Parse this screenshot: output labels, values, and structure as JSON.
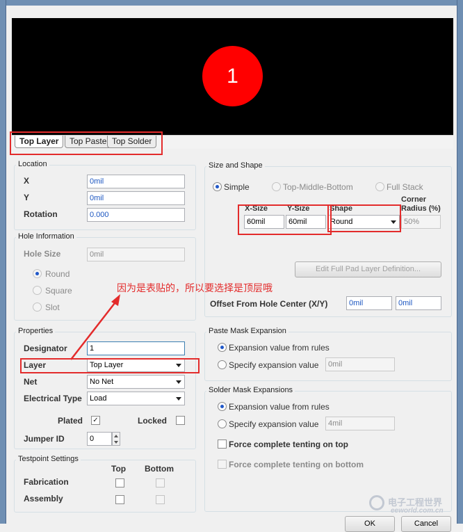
{
  "preview": {
    "pad_number": "1"
  },
  "tabs": [
    "Top Layer",
    "Top Paste",
    "Top Solder"
  ],
  "location": {
    "legend": "Location",
    "x_label": "X",
    "x_value": "0mil",
    "y_label": "Y",
    "y_value": "0mil",
    "rotation_label": "Rotation",
    "rotation_value": "0.000"
  },
  "hole": {
    "legend": "Hole Information",
    "size_label": "Hole Size",
    "size_value": "0mil",
    "round": "Round",
    "square": "Square",
    "slot": "Slot"
  },
  "properties": {
    "legend": "Properties",
    "designator_label": "Designator",
    "designator_value": "1",
    "layer_label": "Layer",
    "layer_value": "Top Layer",
    "net_label": "Net",
    "net_value": "No Net",
    "etype_label": "Electrical Type",
    "etype_value": "Load",
    "plated_label": "Plated",
    "plated_mark": "✓",
    "locked_label": "Locked",
    "jumper_label": "Jumper ID",
    "jumper_value": "0"
  },
  "testpoint": {
    "legend": "Testpoint Settings",
    "top": "Top",
    "bottom": "Bottom",
    "fabrication": "Fabrication",
    "assembly": "Assembly"
  },
  "size_shape": {
    "legend": "Size and Shape",
    "simple": "Simple",
    "tmb": "Top-Middle-Bottom",
    "full_stack": "Full Stack",
    "xsize_hdr": "X-Size",
    "ysize_hdr": "Y-Size",
    "shape_hdr": "Shape",
    "corner_hdr_1": "Corner",
    "corner_hdr_2": "Radius (%)",
    "xsize": "60mil",
    "ysize": "60mil",
    "shape": "Round",
    "corner": "50%",
    "edit_button": "Edit Full Pad Layer Definition...",
    "offset_label": "Offset From Hole Center (X/Y)",
    "offset_x": "0mil",
    "offset_y": "0mil"
  },
  "paste": {
    "legend": "Paste Mask Expansion",
    "from_rules": "Expansion value from rules",
    "specify": "Specify expansion value",
    "value": "0mil"
  },
  "solder": {
    "legend": "Solder Mask Expansions",
    "from_rules": "Expansion value from rules",
    "specify": "Specify expansion value",
    "value": "4mil",
    "tent_top": "Force complete tenting on top",
    "tent_bottom": "Force complete tenting on bottom"
  },
  "buttons": {
    "ok": "OK",
    "cancel": "Cancel"
  },
  "annotation": "因为是表贴的，所以要选择是顶层哦",
  "watermark": {
    "cn": "电子工程世界",
    "en": "eeworld.com.cn"
  },
  "colors": {
    "pad": "#ff0000",
    "highlight": "#e32b2b",
    "accent": "#1f57c8"
  }
}
